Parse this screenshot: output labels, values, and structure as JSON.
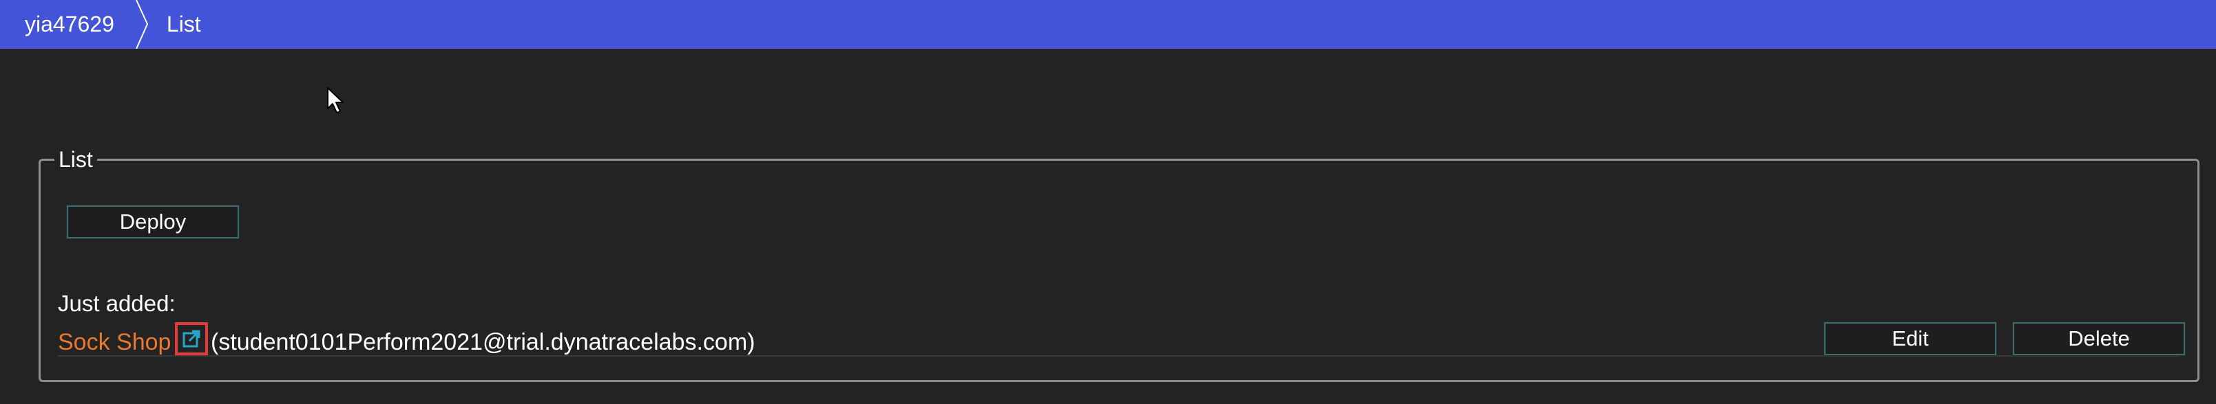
{
  "breadcrumb": {
    "root": "yia47629",
    "current": "List"
  },
  "panel": {
    "legend": "List",
    "deploy_label": "Deploy",
    "just_added_label": "Just added:",
    "items": [
      {
        "name": "Sock Shop",
        "owner": "(student0101Perform2021@trial.dynatracelabs.com)",
        "edit_label": "Edit",
        "delete_label": "Delete"
      }
    ]
  },
  "icons": {
    "breadcrumb_separator": "chevron-right-icon",
    "external_link": "external-link-icon",
    "cursor": "mouse-pointer-icon"
  },
  "colors": {
    "topbar": "#4354d8",
    "background": "#232323",
    "link": "#e87a2f",
    "highlight": "#e23b3b",
    "button_border": "#3a6f72"
  }
}
